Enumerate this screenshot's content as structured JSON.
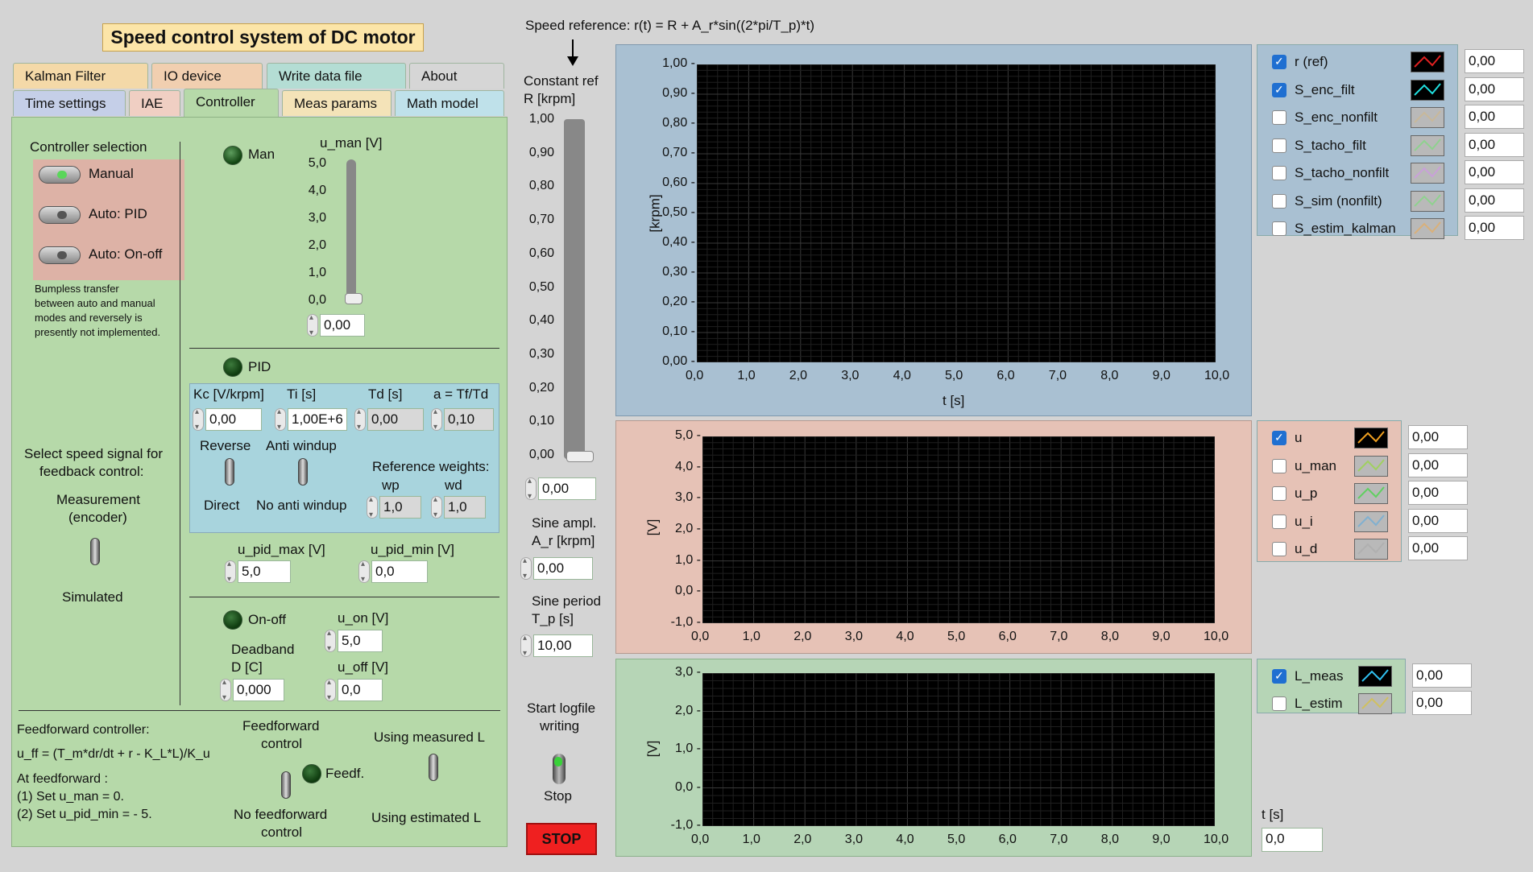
{
  "title": "Speed control system of DC motor",
  "tabs_row1": [
    "Kalman Filter",
    "IO device",
    "Write data file",
    "About"
  ],
  "tabs_row2": [
    "Time settings",
    "IAE",
    "Controller",
    "Meas params",
    "Math model"
  ],
  "active_tab": "Controller",
  "controller": {
    "selection_label": "Controller selection",
    "options": [
      "Manual",
      "Auto: PID",
      "Auto: On-off"
    ],
    "selected": "Manual",
    "note": [
      "Bumpless transfer",
      "between auto and manual",
      "modes and reversely is",
      "presently not implemented."
    ],
    "man_led": "Man",
    "u_man_label": "u_man [V]",
    "u_man_ticks": [
      "5,0",
      "4,0",
      "3,0",
      "2,0",
      "1,0",
      "0,0"
    ],
    "u_man_value": "0,00",
    "pid_led": "PID",
    "kc_label": "Kc [V/krpm]",
    "ti_label": "Ti [s]",
    "td_label": "Td [s]",
    "a_label": "a = Tf/Td",
    "kc": "0,00",
    "ti": "1,00E+6",
    "td": "0,00",
    "a": "0,10",
    "reverse": "Reverse",
    "direct": "Direct",
    "anti_windup": "Anti windup",
    "no_anti_windup": "No anti windup",
    "ref_weights": "Reference weights:",
    "wp_label": "wp",
    "wd_label": "wd",
    "wp": "1,0",
    "wd": "1,0",
    "u_pid_max_label": "u_pid_max [V]",
    "u_pid_min_label": "u_pid_min [V]",
    "u_pid_max": "5,0",
    "u_pid_min": "0,0",
    "onoff_led": "On-off",
    "u_on_label": "u_on [V]",
    "u_on": "5,0",
    "deadband_label": [
      "Deadband",
      "D [C]"
    ],
    "deadband": "0,000",
    "u_off_label": "u_off [V]",
    "u_off": "0,0",
    "select_signal": [
      "Select speed signal for",
      "feedback control:"
    ],
    "meas_encoder": [
      "Measurement",
      "(encoder)"
    ],
    "simulated": "Simulated",
    "ff_title": "Feedforward controller:",
    "ff_formula": "u_ff = (T_m*dr/dt + r - K_L*L)/K_u",
    "ff_at": "At feedforward :",
    "ff_step1": "(1) Set u_man = 0.",
    "ff_step2": "(2) Set u_pid_min = - 5.",
    "ff_control": [
      "Feedforward",
      "control"
    ],
    "ff_led": "Feedf.",
    "no_ff_control": [
      "No feedforward",
      "control"
    ],
    "using_measured": "Using measured L",
    "using_estimated": "Using estimated L"
  },
  "reference": {
    "formula": "Speed reference: r(t) = R + A_r*sin((2*pi/T_p)*t)",
    "const_ref_label": [
      "Constant ref",
      "R [krpm]"
    ],
    "slider_ticks": [
      "1,00",
      "0,90",
      "0,80",
      "0,70",
      "0,60",
      "0,50",
      "0,40",
      "0,30",
      "0,20",
      "0,10",
      "0,00"
    ],
    "const_ref": "0,00",
    "sine_ampl_label": [
      "Sine ampl.",
      "A_r [krpm]"
    ],
    "sine_ampl": "0,00",
    "sine_period_label": [
      "Sine period",
      "T_p [s]"
    ],
    "sine_period": "10,00",
    "logfile_label": [
      "Start logfile",
      "writing"
    ],
    "stop_switch": "Stop",
    "stop_button": "STOP"
  },
  "charts": {
    "x_ticks": [
      "0,0",
      "1,0",
      "2,0",
      "3,0",
      "4,0",
      "5,0",
      "6,0",
      "7,0",
      "8,0",
      "9,0",
      "10,0"
    ],
    "t_label": "t [s]",
    "t_value": "0,0"
  },
  "chart_data": [
    {
      "type": "line",
      "ylabel": "[krpm]",
      "xlabel": "t [s]",
      "ylim": [
        0,
        1
      ],
      "xlim": [
        0,
        10
      ],
      "yticks": [
        "1,00",
        "0,90",
        "0,80",
        "0,70",
        "0,60",
        "0,50",
        "0,40",
        "0,30",
        "0,20",
        "0,10",
        "0,00"
      ],
      "series": [
        {
          "name": "r (ref)",
          "checked": true,
          "color": "#e02020",
          "value": "0,00"
        },
        {
          "name": "S_enc_filt",
          "checked": true,
          "color": "#20e0e0",
          "value": "0,00"
        },
        {
          "name": "S_enc_nonfilt",
          "checked": false,
          "color": "#c8b89a",
          "value": "0,00"
        },
        {
          "name": "S_tacho_filt",
          "checked": false,
          "color": "#8fd18f",
          "value": "0,00"
        },
        {
          "name": "S_tacho_nonfilt",
          "checked": false,
          "color": "#c9a0d9",
          "value": "0,00"
        },
        {
          "name": "S_sim (nonfilt)",
          "checked": false,
          "color": "#8fd18f",
          "value": "0,00"
        },
        {
          "name": "S_estim_kalman",
          "checked": false,
          "color": "#d9b07a",
          "value": "0,00"
        }
      ]
    },
    {
      "type": "line",
      "ylabel": "[V]",
      "ylim": [
        -1,
        5
      ],
      "xlim": [
        0,
        10
      ],
      "yticks": [
        "5,0",
        "4,0",
        "3,0",
        "2,0",
        "1,0",
        "0,0",
        "-1,0"
      ],
      "series": [
        {
          "name": "u",
          "checked": true,
          "color": "#f0a020",
          "value": "0,00"
        },
        {
          "name": "u_man",
          "checked": false,
          "color": "#a0d060",
          "value": "0,00"
        },
        {
          "name": "u_p",
          "checked": false,
          "color": "#60d060",
          "value": "0,00"
        },
        {
          "name": "u_i",
          "checked": false,
          "color": "#80b0d0",
          "value": "0,00"
        },
        {
          "name": "u_d",
          "checked": false,
          "color": "#b0b0b0",
          "value": "0,00"
        }
      ]
    },
    {
      "type": "line",
      "ylabel": "[V]",
      "ylim": [
        -1,
        3
      ],
      "xlim": [
        0,
        10
      ],
      "yticks": [
        "3,0",
        "2,0",
        "1,0",
        "0,0",
        "-1,0"
      ],
      "series": [
        {
          "name": "L_meas",
          "checked": true,
          "color": "#30c0f0",
          "value": "0,00"
        },
        {
          "name": "L_estim",
          "checked": false,
          "color": "#d0c060",
          "value": "0,00"
        }
      ]
    }
  ]
}
